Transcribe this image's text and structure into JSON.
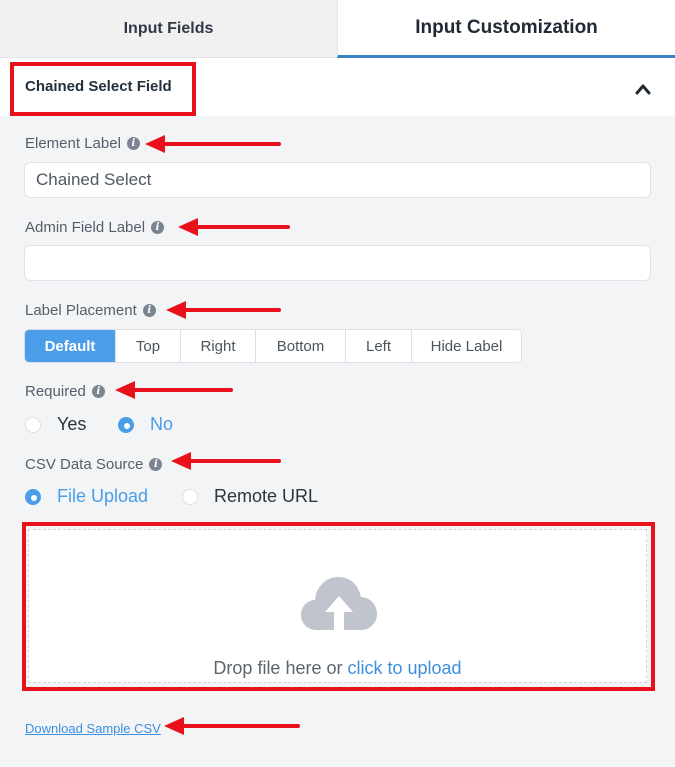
{
  "tabs": [
    {
      "label": "Input Fields"
    },
    {
      "label": "Input Customization"
    }
  ],
  "section": {
    "title": "Chained Select Field"
  },
  "info_glyph": "i",
  "fields": {
    "element_label": {
      "label": "Element Label",
      "value": "Chained Select"
    },
    "admin_label": {
      "label": "Admin Field Label",
      "value": ""
    },
    "placement": {
      "label": "Label Placement",
      "options": [
        "Default",
        "Top",
        "Right",
        "Bottom",
        "Left",
        "Hide Label"
      ],
      "selected": "Default"
    },
    "required": {
      "label": "Required",
      "options": [
        "Yes",
        "No"
      ],
      "selected": "No"
    },
    "csv_source": {
      "label": "CSV Data Source",
      "options": [
        "File Upload",
        "Remote URL"
      ],
      "selected": "File Upload"
    }
  },
  "upload": {
    "icon": "cloud-upload-icon",
    "text_prefix": "Drop file here or ",
    "link_text": "click to upload"
  },
  "sample_link": "Download Sample CSV",
  "colors": {
    "accent": "#4a9de9",
    "annotation_red": "#e8111b",
    "link": "#3d8fe0",
    "tab_underline": "#3b82c4"
  }
}
